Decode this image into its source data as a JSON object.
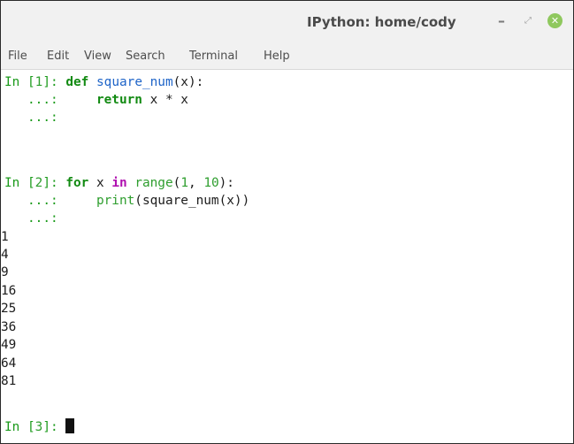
{
  "window": {
    "title": "IPython: home/cody",
    "minimize_glyph": "–",
    "maximize_glyph": "⤢",
    "close_glyph": "✕"
  },
  "menu": [
    "File",
    "Edit",
    "View",
    "Search",
    "Terminal",
    "Help"
  ],
  "terminal": {
    "in1_prompt": "In [",
    "in1_num": "1",
    "in1_close": "]: ",
    "in1_def": "def",
    "in1_fn": "square_num",
    "in1_args": "(x):",
    "cont": "   ...: ",
    "in1_indent": "    ",
    "in1_return": "return",
    "in1_expr": " x * x",
    "in2_prompt": "In [",
    "in2_num": "2",
    "in2_close": "]: ",
    "in2_for": "for",
    "in2_var": " x ",
    "in2_in": "in",
    "in2_range": " range",
    "in2_open": "(",
    "in2_a": "1",
    "in2_sep": ", ",
    "in2_b": "10",
    "in2_end": "):",
    "in2_indent": "    ",
    "in2_print": "print",
    "in2_body": "(square_num(x))",
    "outputs": [
      "1",
      "4",
      "9",
      "16",
      "25",
      "36",
      "49",
      "64",
      "81"
    ],
    "in3_prompt": "In [",
    "in3_num": "3",
    "in3_close": "]: "
  },
  "colors": {
    "prompt": "#1a9a1a",
    "keyword": "#128a12",
    "function": "#1e64c8",
    "operator_in": "#b012b0",
    "close_button": "#8fc85e"
  }
}
